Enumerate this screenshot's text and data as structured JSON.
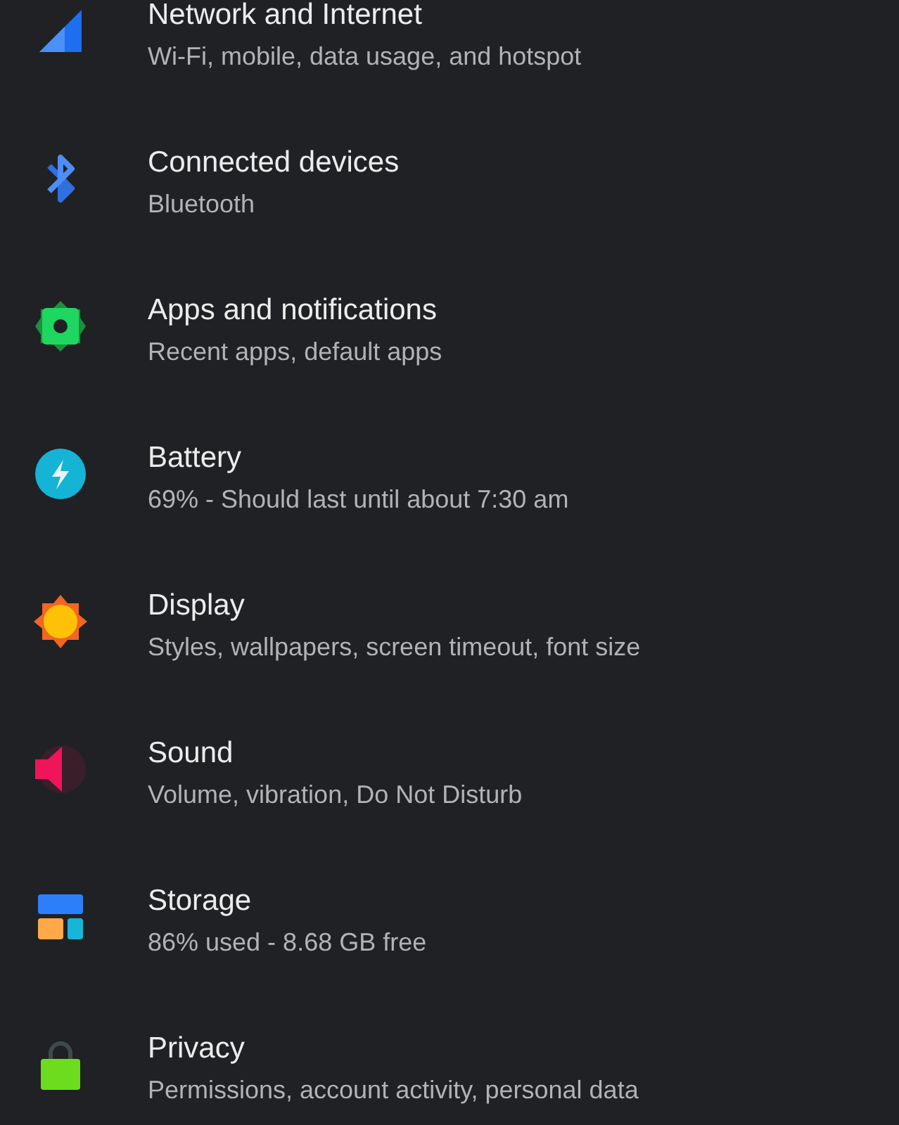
{
  "settings": [
    {
      "kind": "network",
      "title": "Network and Internet",
      "summary": "Wi-Fi, mobile, data usage, and hotspot"
    },
    {
      "kind": "bluetooth",
      "title": "Connected devices",
      "summary": "Bluetooth"
    },
    {
      "kind": "apps",
      "title": "Apps and notifications",
      "summary": "Recent apps, default apps"
    },
    {
      "kind": "battery",
      "title": "Battery",
      "summary": "69% - Should last until about 7:30 am"
    },
    {
      "kind": "display",
      "title": "Display",
      "summary": "Styles, wallpapers, screen timeout, font size"
    },
    {
      "kind": "sound",
      "title": "Sound",
      "summary": "Volume, vibration, Do Not Disturb"
    },
    {
      "kind": "storage",
      "title": "Storage",
      "summary": "86% used - 8.68 GB free"
    },
    {
      "kind": "privacy",
      "title": "Privacy",
      "summary": "Permissions, account activity, personal data"
    }
  ]
}
